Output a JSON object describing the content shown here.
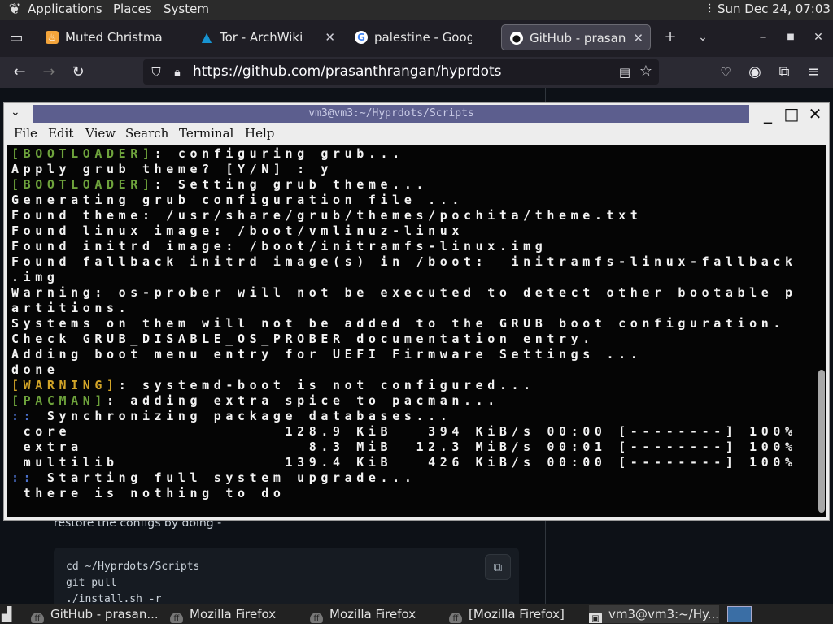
{
  "top_panel": {
    "menus": [
      "Applications",
      "Places",
      "System"
    ],
    "clock": "Sun Dec 24, 07:03"
  },
  "browser": {
    "tabs": [
      {
        "label": "Muted Christmas",
        "icon": "flame-icon",
        "color": "#f3a43b"
      },
      {
        "label": "Tor - ArchWiki",
        "icon": "arch-icon",
        "color": "#1793d1"
      },
      {
        "label": "palestine - Google",
        "icon": "google-icon",
        "color": "#4285f4"
      },
      {
        "label": "GitHub - prasanth",
        "icon": "github-icon",
        "color": "#ffffff"
      }
    ],
    "url": "https://github.com/prasanthrangan/hyprdots"
  },
  "page": {
    "restore_text": "restore the configs by doing -",
    "code_lines": [
      "cd ~/Hyprdots/Scripts",
      "git pull",
      "./install.sh -r"
    ]
  },
  "terminal": {
    "title": "vm3@vm3:~/Hyprdots/Scripts",
    "menu": [
      "File",
      "Edit",
      "View",
      "Search",
      "Terminal",
      "Help"
    ],
    "lines": {
      "l1_tag": "[BOOTLOADER]",
      "l1_rest": ": configuring grub...",
      "l2": "Apply grub theme? [Y/N] : y",
      "l3_tag": "[BOOTLOADER]",
      "l3_rest": ": Setting grub theme...",
      "l4": "Generating grub configuration file ...",
      "l5": "Found theme: /usr/share/grub/themes/pochita/theme.txt",
      "l6": "Found linux image: /boot/vmlinuz-linux",
      "l7": "Found initrd image: /boot/initramfs-linux.img",
      "l8": "Found fallback initrd image(s) in /boot:  initramfs-linux-fallback",
      "l9": ".img",
      "l10": "Warning: os-prober will not be executed to detect other bootable p",
      "l11": "artitions.",
      "l12": "Systems on them will not be added to the GRUB boot configuration.",
      "l13": "Check GRUB_DISABLE_OS_PROBER documentation entry.",
      "l14": "Adding boot menu entry for UEFI Firmware Settings ...",
      "l15": "done",
      "l16_tag": "[WARNING]",
      "l16_rest": ": systemd-boot is not configured...",
      "l17_tag": "[PACMAN]",
      "l17_rest": ": adding extra spice to pacman...",
      "l18_sym": "::",
      "l18_rest": " Synchronizing package databases...",
      "l19": " core                  128.9 KiB   394 KiB/s 00:00 [--------] 100%",
      "l20": " extra                   8.3 MiB  12.3 MiB/s 00:01 [--------] 100%",
      "l21": " multilib              139.4 KiB   426 KiB/s 00:00 [--------] 100%",
      "l22_sym": "::",
      "l22_rest": " Starting full system upgrade...",
      "l23": " there is nothing to do"
    }
  },
  "taskbar": {
    "items": [
      {
        "label": "GitHub - prasan..."
      },
      {
        "label": "Mozilla Firefox"
      },
      {
        "label": "Mozilla Firefox"
      },
      {
        "label": "[Mozilla Firefox]"
      },
      {
        "label": "vm3@vm3:~/Hy..."
      }
    ]
  }
}
